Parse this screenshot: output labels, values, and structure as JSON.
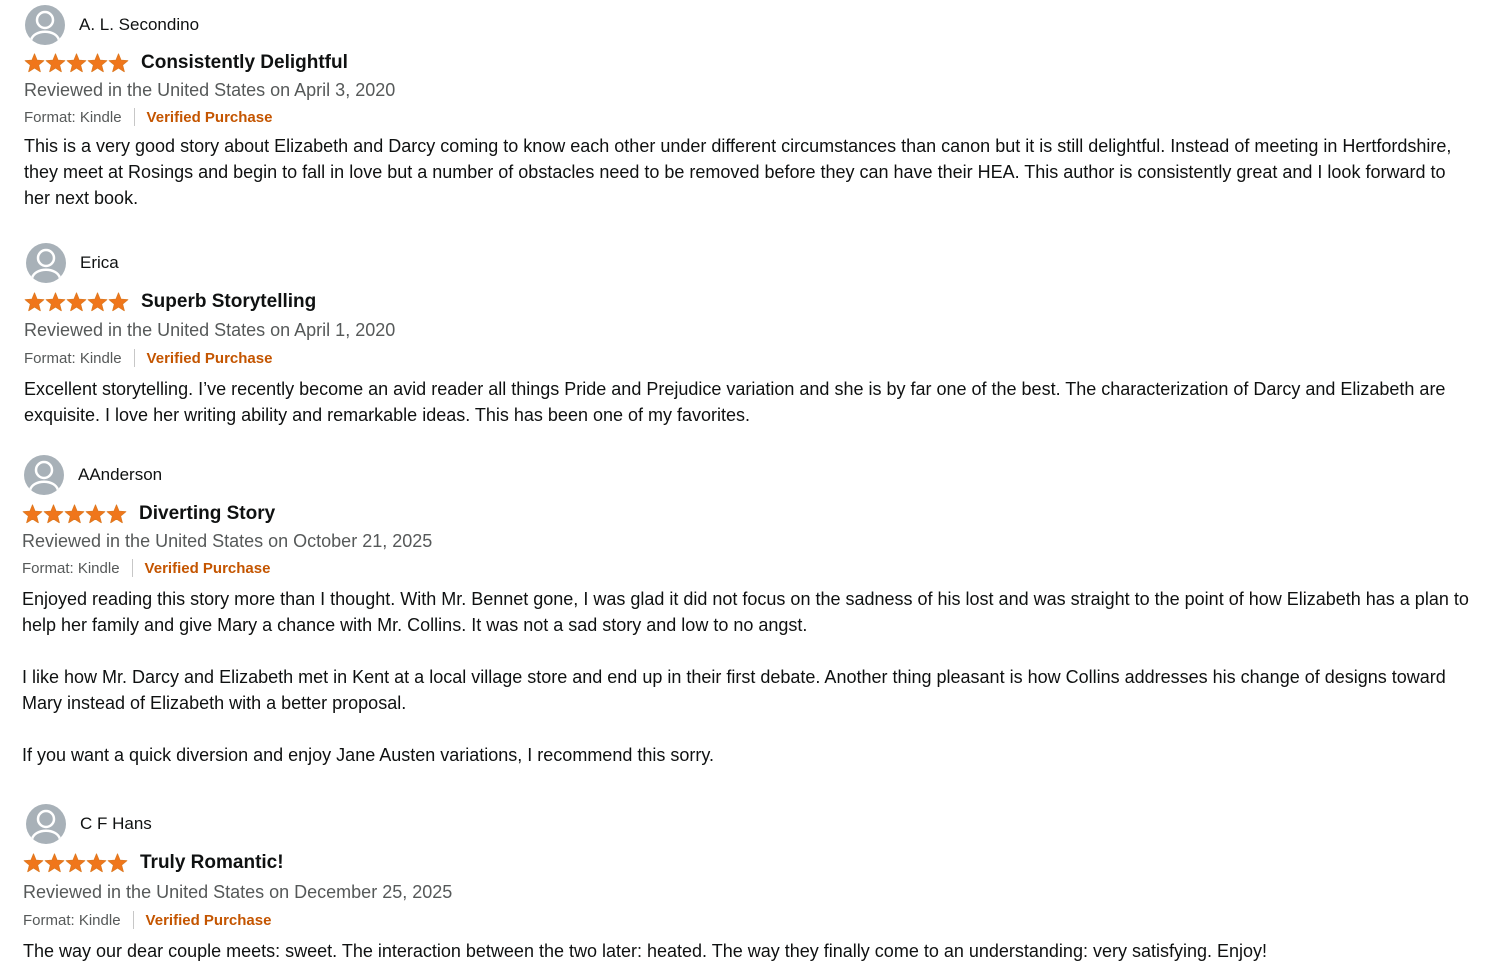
{
  "accent": "#c45500",
  "star_color": "#f0761b",
  "reviews": [
    {
      "name": "A. L. Secondino",
      "rating": 5,
      "title": "Consistently Delightful",
      "date": "Reviewed in the United States on April 3, 2020",
      "format": "Format: Kindle",
      "verified": "Verified Purchase",
      "paragraphs": [
        "This is a very good story about Elizabeth and Darcy coming to know each other under different circumstances than canon but it is still delightful. Instead of meeting in Hertfordshire, they meet at Rosings and begin to fall in love but a number of obstacles need to be removed before they can have their HEA. This author is consistently great and I look forward to her next book."
      ]
    },
    {
      "name": "Erica",
      "rating": 5,
      "title": "Superb Storytelling",
      "date": "Reviewed in the United States on April 1, 2020",
      "format": "Format: Kindle",
      "verified": "Verified Purchase",
      "paragraphs": [
        "Excellent storytelling. I’ve recently become an avid reader all things Pride and Prejudice variation and she is by far one of the best. The characterization of Darcy and Elizabeth are exquisite. I love her writing ability and remarkable ideas. This has been one of my favorites."
      ]
    },
    {
      "name": "AAnderson",
      "rating": 5,
      "title": "Diverting Story",
      "date": "Reviewed in the United States on October 21, 2025",
      "format": "Format: Kindle",
      "verified": "Verified Purchase",
      "paragraphs": [
        "Enjoyed reading this story more than I thought. With Mr. Bennet gone, I was glad it did not focus on the sadness of his lost and was straight to the point of how Elizabeth has a plan to help her family and give Mary a chance with Mr. Collins. It was not a sad story and low to no angst.",
        "I like how Mr. Darcy and Elizabeth met in Kent at a local village store and end up in their first debate. Another thing pleasant is how Collins addresses his change of designs toward Mary instead of Elizabeth with a better proposal.",
        "If you want a quick diversion and enjoy Jane Austen variations, I recommend this sorry."
      ]
    },
    {
      "name": "C F Hans",
      "rating": 5,
      "title": "Truly Romantic!",
      "date": "Reviewed in the United States on December 25, 2025",
      "format": "Format: Kindle",
      "verified": "Verified Purchase",
      "paragraphs": [
        "The way our dear couple meets: sweet. The interaction between the two later: heated. The way they finally come to an understanding: very satisfying. Enjoy!"
      ]
    }
  ]
}
